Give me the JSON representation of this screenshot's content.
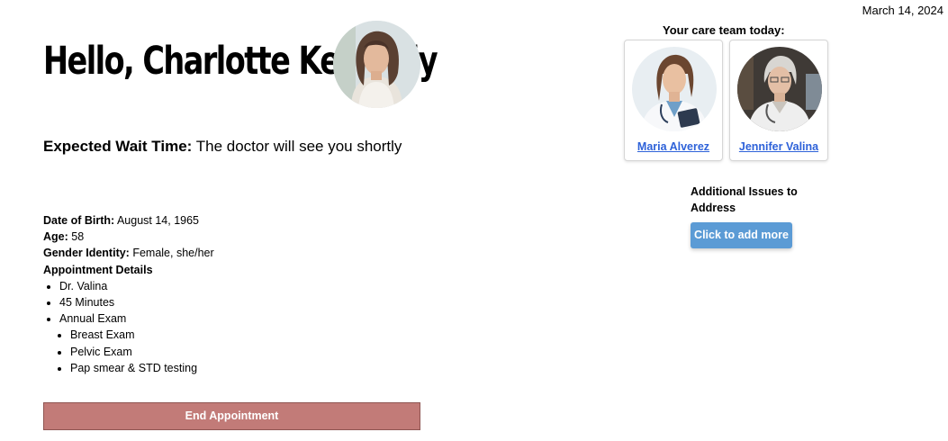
{
  "date": "March 14, 2024",
  "greeting": "Hello, Charlotte Kennedy",
  "wait": {
    "label": "Expected Wait Time:",
    "value": " The doctor will see you shortly"
  },
  "patient": {
    "dob_label": "Date of Birth:",
    "dob": " August 14, 1965",
    "age_label": "Age:",
    "age": " 58",
    "gender_label": "Gender Identity:",
    "gender": " Female, she/her"
  },
  "appointment": {
    "title": "Appointment Details",
    "items": [
      "Dr. Valina",
      "45 Minutes",
      "Annual Exam"
    ],
    "sub_items": [
      "Breast Exam",
      "Pelvic Exam",
      "Pap smear & STD testing"
    ]
  },
  "end_button": "End Appointment",
  "care_team": {
    "title": "Your care team today:",
    "members": [
      {
        "name": "Maria Alverez"
      },
      {
        "name": "Jennifer Valina"
      }
    ]
  },
  "issues": {
    "title": "Additional Issues to Address",
    "button": "Click to add more"
  },
  "colors": {
    "end_button": "#c27b78",
    "add_button": "#5b9bd5",
    "link": "#2e62d9"
  }
}
